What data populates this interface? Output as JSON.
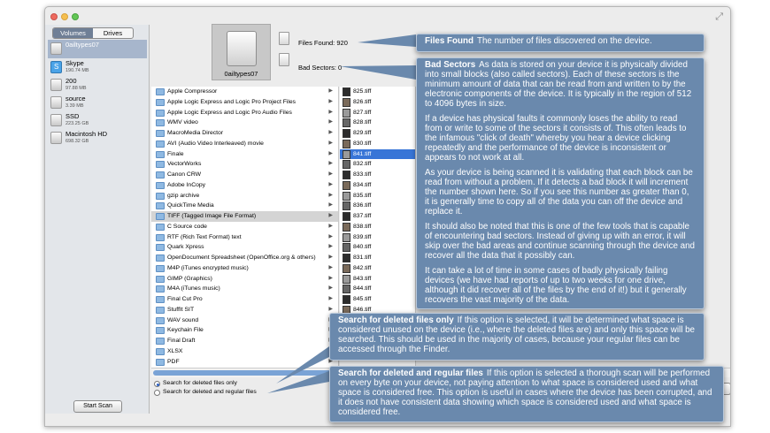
{
  "sidebar": {
    "tabs": [
      "Volumes",
      "Drives"
    ],
    "active_tab": "Volumes",
    "drives": [
      {
        "name": "0ailtypes07",
        "size": "",
        "selected": true
      },
      {
        "name": "Skype",
        "size": "190.74 MB",
        "selected": false
      },
      {
        "name": "200",
        "size": "97.88 MB",
        "selected": false
      },
      {
        "name": "source",
        "size": "3.39 MB",
        "selected": false
      },
      {
        "name": "SSD",
        "size": "223.25 GB",
        "selected": false
      },
      {
        "name": "Macintosh HD",
        "size": "698.32 GB",
        "selected": false
      }
    ],
    "start_scan_label": "Start Scan"
  },
  "header": {
    "device_name": "0ailtypes07",
    "files_found_label": "Files Found:",
    "files_found_value": "920",
    "bad_sectors_label": "Bad Sectors:",
    "bad_sectors_value": "0"
  },
  "file_types": [
    "Apple Compressor",
    "Apple Logic Express and Logic Pro Project Files",
    "Apple Logic Express and Logic Pro Audio Files",
    "WMV video",
    "MacroMedia Director",
    "AVI (Audio Video Interleaved) movie",
    "Finale",
    "VectorWorks",
    "Canon CRW",
    "Adobe InCopy",
    "gzip archive",
    "QuickTime Media",
    "TIFF (Tagged Image File Format)",
    "C Source code",
    "RTF (Rich Text Format) text",
    "Quark Xpress",
    "OpenDocument Spreadsheet (OpenOffice.org & others)",
    "M4P (iTunes encrypted music)",
    "GIMP (Graphics)",
    "M4A (iTunes music)",
    "Final Cut Pro",
    "StuffIt SIT",
    "WAV sound",
    "Keychain File",
    "Final Draft",
    "XLSX",
    "PDF"
  ],
  "selected_type": "TIFF (Tagged Image File Format)",
  "files": [
    "825.tiff",
    "826.tiff",
    "827.tiff",
    "828.tiff",
    "829.tiff",
    "830.tiff",
    "841.tiff",
    "832.tiff",
    "833.tiff",
    "834.tiff",
    "835.tiff",
    "836.tiff",
    "837.tiff",
    "838.tiff",
    "839.tiff",
    "840.tiff",
    "831.tiff",
    "842.tiff",
    "843.tiff",
    "844.tiff",
    "845.tiff",
    "846.tiff"
  ],
  "selected_file": "841.tiff",
  "options": {
    "deleted_only": "Search for deleted files only",
    "deleted_and_regular": "Search for deleted and regular files",
    "selected": "deleted_only"
  },
  "callouts": {
    "files_found": {
      "title": "Files Found",
      "text": "The number of files discovered on the device."
    },
    "bad_sectors": {
      "title": "Bad Sectors",
      "p1": "As data is stored on your device it is physically divided into small blocks (also called sectors). Each of these sectors is the minimum amount of data that can be read from and written to by the electronic components of the device. It is typically in the region of 512 to 4096 bytes in size.",
      "p2": "If a device has physical faults it commonly loses the ability to read from or write to some of the sectors it consists of. This often leads to the infamous \"click of death\" whereby you hear a device clicking repeatedly and the performance of the device is inconsistent or appears to not work at all.",
      "p3": "As your device is being scanned it is validating that each block can be read from without a problem. If it detects a bad block it will increment the number shown here. So if you see this number as greater than 0, it is generally time to copy all of the data you can off the device and replace it.",
      "p4": "It should also be noted that this is one of the few tools that is capable of encountering bad sectors. Instead of giving up with an error, it will skip over the bad areas and continue scanning through the device and recover all the data that it possibly can.",
      "p5": "It can take a lot of time in some cases of badly physically failing devices (we have had reports of up to two weeks for one drive, although it did recover all of the files by the end of it!) but it generally recovers the vast majority of the data."
    },
    "deleted_only": {
      "title": "Search for deleted files only",
      "text": "If this option is selected, it will be determined what space is considered unused on the device (i.e., where the deleted files are) and only this space will be searched. This should be used in the majority of cases, because your regular files can be accessed through the Finder."
    },
    "deleted_and_regular": {
      "title": "Search for deleted and regular files",
      "text": "If this option is selected a thorough scan will be performed on every byte on your device, not paying attention to what space is considered used and what space is considered free. This option is useful in cases where the device has been corrupted, and it does not have consistent data showing which space is considered used and what space is considered free."
    }
  },
  "colors": {
    "callout_bg": "#6a89ad",
    "selection": "#3875d7",
    "sidebar_selected": "#a7b6cc"
  }
}
